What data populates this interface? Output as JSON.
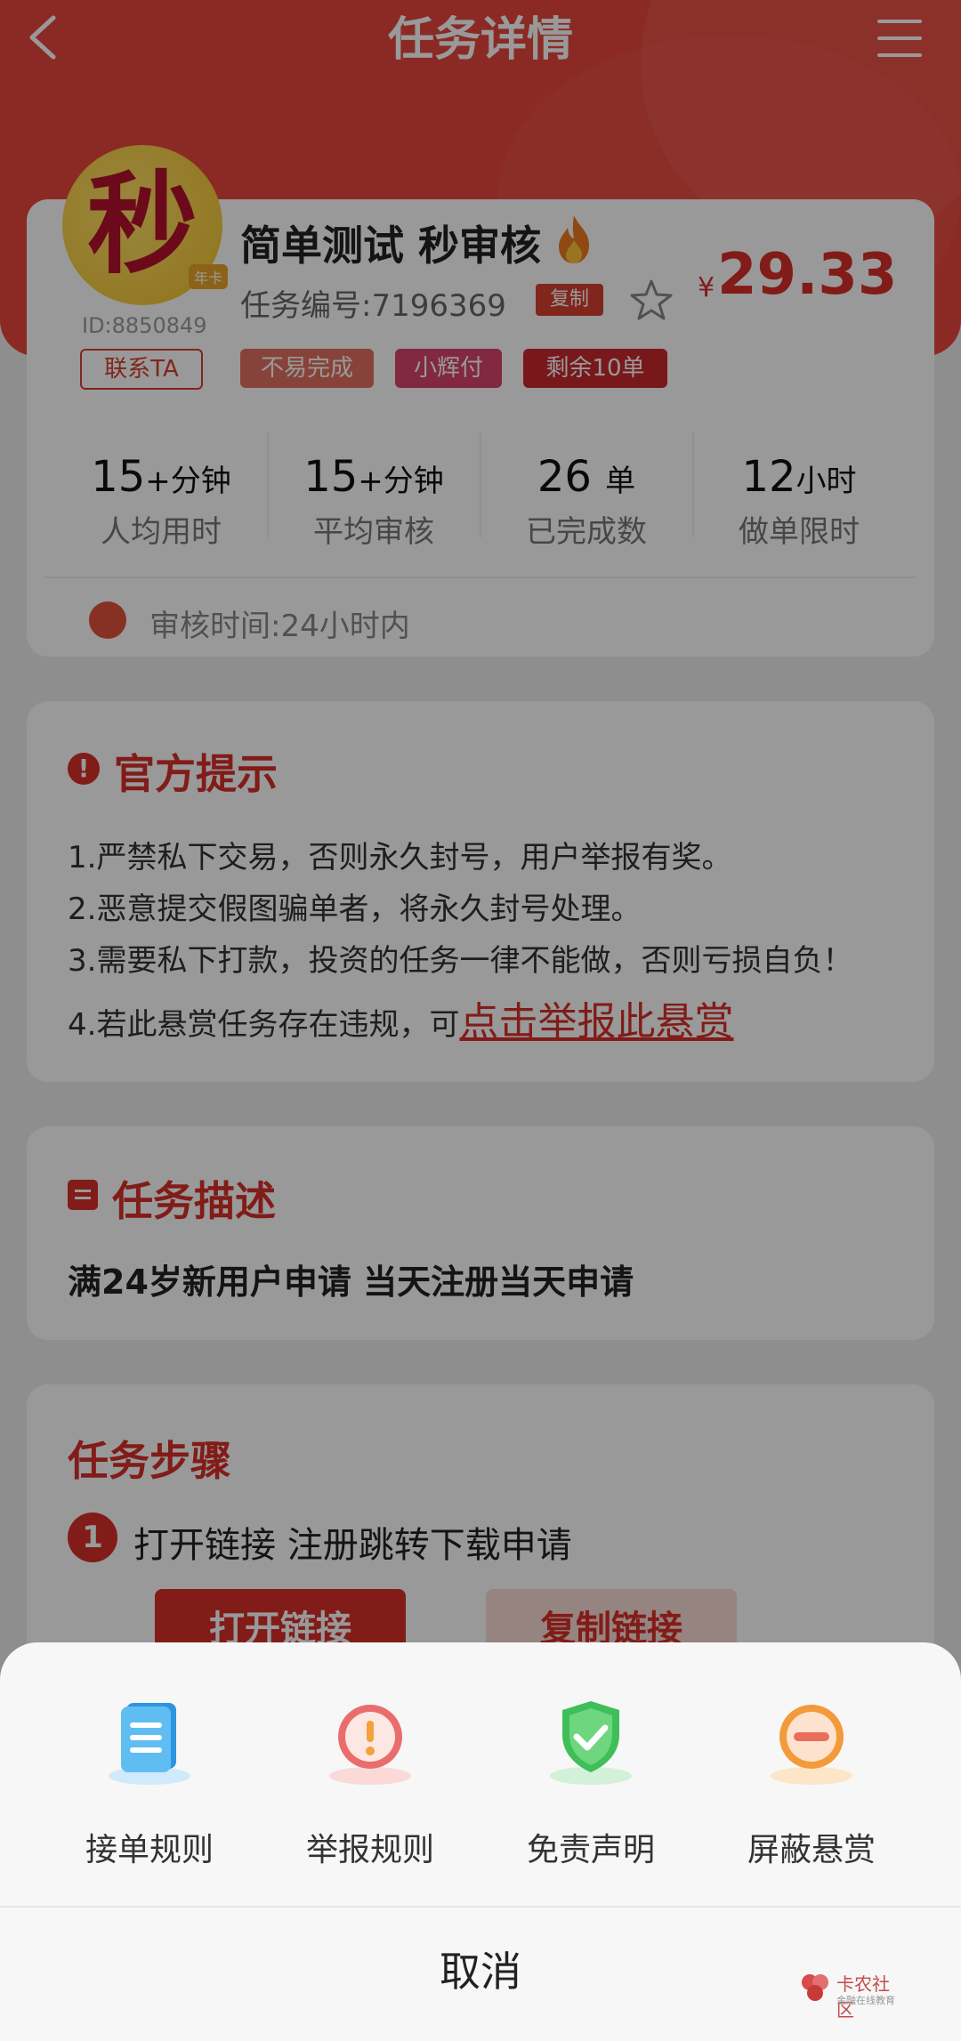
{
  "header": {
    "title": "任务详情"
  },
  "task": {
    "logo_char": "秒",
    "logo_tag": "年卡",
    "user_id": "ID:8850849",
    "contact_label": "联系TA",
    "name": "简单测试 秒审核",
    "number": "任务编号:7196369",
    "copy_label": "复制",
    "currency": "¥",
    "price": "29.33",
    "badges": [
      "不易完成",
      "小辉付",
      "剩余10单"
    ],
    "stats": [
      {
        "value": "15",
        "unit": "+分钟",
        "label": "人均用时"
      },
      {
        "value": "15",
        "unit": "+分钟",
        "label": "平均审核"
      },
      {
        "value": "26",
        "unit": "单",
        "label": "已完成数"
      },
      {
        "value": "12",
        "unit": "小时",
        "label": "做单限时"
      }
    ],
    "review_time": "审核时间:24小时内"
  },
  "notice": {
    "title": "官方提示",
    "items": [
      "1.严禁私下交易，否则永久封号，用户举报有奖。",
      "2.恶意提交假图骗单者，将永久封号处理。",
      "3.需要私下打款，投资的任务一律不能做，否则亏损自负！",
      "4.若此悬赏任务存在违规，可"
    ],
    "report_link": "点击举报此悬赏"
  },
  "description": {
    "title": "任务描述",
    "text": "满24岁新用户申请  当天注册当天申请"
  },
  "steps": {
    "title": "任务步骤",
    "items": [
      {
        "num": "1",
        "text": "打开链接 注册跳转下载申请",
        "open_label": "打开链接",
        "copy_label": "复制链接"
      }
    ]
  },
  "sheet": {
    "actions": [
      {
        "icon": "rules-list-icon",
        "label": "接单规则",
        "color": "#3aa5e6"
      },
      {
        "icon": "report-warning-icon",
        "label": "举报规则",
        "color": "#e85a5a"
      },
      {
        "icon": "shield-check-icon",
        "label": "免责声明",
        "color": "#3fc25a"
      },
      {
        "icon": "block-minus-icon",
        "label": "屏蔽悬赏",
        "color": "#f39a3b"
      }
    ],
    "cancel_label": "取消"
  },
  "watermark": {
    "name": "卡农社区",
    "sub": "金融在线教育"
  },
  "colors": {
    "primary": "#d8302a",
    "header": "#e8463c"
  }
}
